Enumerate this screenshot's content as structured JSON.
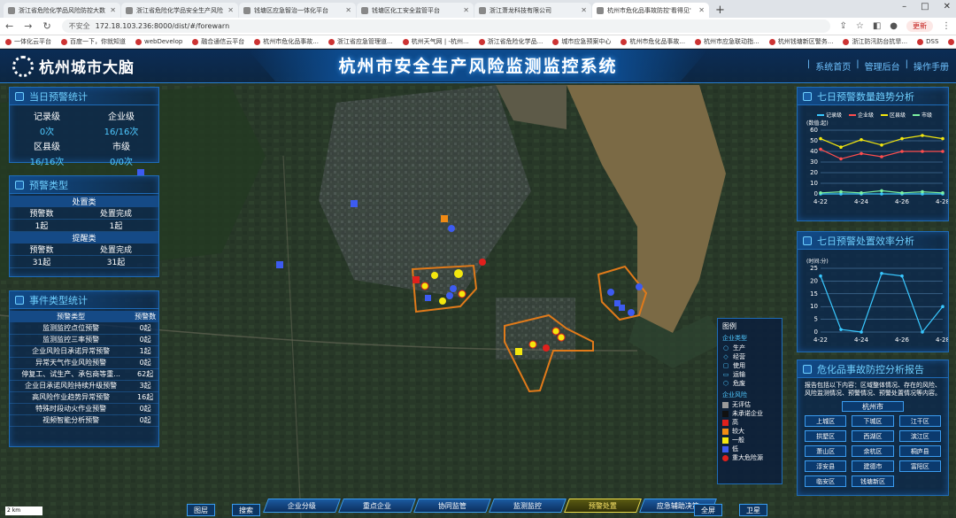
{
  "browser": {
    "tabs": [
      {
        "label": "浙江省危险化学品风险防控大数",
        "active": false
      },
      {
        "label": "浙江省危险化学品安全生产风险",
        "active": false
      },
      {
        "label": "钱塘区应急智治一体化平台",
        "active": false
      },
      {
        "label": "钱塘区化工安全监管平台",
        "active": false
      },
      {
        "label": "浙江萧龙科技有限公司",
        "active": false
      },
      {
        "label": "杭州市危化品事故防控'看得见'",
        "active": true
      }
    ],
    "new_tab": "+",
    "security": "不安全",
    "url": "172.18.103.236:8000/dist/#/forewarn",
    "update_btn": "更新",
    "bookmarks": [
      "一体化云平台",
      "百度一下，你就知道",
      "webDevelop",
      "融合通信云平台",
      "杭州市危化品事故...",
      "浙江省应急管理道...",
      "杭州天气网 | -杭州...",
      "浙江省危险化学品...",
      "城市应急预案中心",
      "杭州市危化品事故...",
      "杭州市应急联动指...",
      "杭州钱塘新区警务...",
      "浙江防汛防台抗旱...",
      "DSS",
      "实时监控调阅"
    ]
  },
  "header": {
    "logo": "杭州城市大脑",
    "title": "杭州市安全生产风险监测监控系统",
    "nav": [
      "系统首页",
      "管理后台",
      "操作手册"
    ]
  },
  "warning_stats": {
    "title": "当日预警统计",
    "items": [
      {
        "label": "记录级",
        "value": "0次"
      },
      {
        "label": "企业级",
        "value": "16/16次"
      },
      {
        "label": "区县级",
        "value": "16/16次"
      },
      {
        "label": "市级",
        "value": "0/0次"
      }
    ]
  },
  "warning_type": {
    "title": "预警类型",
    "group1": {
      "name": "处置类",
      "col1": "预警数",
      "col2": "处置完成",
      "v1": "1起",
      "v2": "1起"
    },
    "group2": {
      "name": "提醒类",
      "col1": "预警数",
      "col2": "处置完成",
      "v1": "31起",
      "v2": "31起"
    }
  },
  "event_stats": {
    "title": "事件类型统计",
    "headers": [
      "预警类型",
      "预警数"
    ],
    "rows": [
      [
        "监测监控点位预警",
        "0起"
      ],
      [
        "监测监控三率预警",
        "0起"
      ],
      [
        "企业风险日承诺异常预警",
        "1起"
      ],
      [
        "异常天气作业风险预警",
        "0起"
      ],
      [
        "停复工、试生产、承包商等重...",
        "62起"
      ],
      [
        "企业日承诺风险持续升级预警",
        "3起"
      ],
      [
        "高风险作业趋势异常预警",
        "16起"
      ],
      [
        "特殊时段动火作业预警",
        "0起"
      ],
      [
        "视频智能分析预警",
        "0起"
      ]
    ]
  },
  "trend": {
    "title": "七日预警数量趋势分析",
    "legend": [
      "记录级",
      "企业级",
      "区县级",
      "市级"
    ],
    "unit": "(数值:起)"
  },
  "rate": {
    "title": "七日预警处置效率分析",
    "unit": "(时间:分)"
  },
  "report": {
    "title": "危化品事故防控分析报告",
    "text": "报告包括以下内容：区域整体情况、存在的风险、风险监测情况、预警情况、预警处置情况等内容。",
    "city": "杭州市",
    "districts": [
      "上城区",
      "下城区",
      "江干区",
      "拱墅区",
      "西湖区",
      "滨江区",
      "萧山区",
      "余杭区",
      "桐庐县",
      "淳安县",
      "建德市",
      "富阳区",
      "临安区",
      "钱塘新区"
    ]
  },
  "legend": {
    "title": "图例",
    "sec1": "企业类型",
    "types": [
      "生产",
      "经营",
      "使用",
      "运输",
      "危废"
    ],
    "sec2": "企业风险",
    "risks": [
      {
        "label": "无评估",
        "color": "#9a9a9a"
      },
      {
        "label": "未承诺企业",
        "color": "#111111"
      },
      {
        "label": "高",
        "color": "#e0201c"
      },
      {
        "label": "较大",
        "color": "#f08a14"
      },
      {
        "label": "一般",
        "color": "#f3e70e"
      },
      {
        "label": "低",
        "color": "#3d5bf0"
      },
      {
        "label": "重大危险源",
        "color": "#e0201c"
      }
    ]
  },
  "bottom_nav": [
    "企业分级",
    "重点企业",
    "协同监管",
    "监测监控",
    "预警处置",
    "应急辅助决策"
  ],
  "bottom_active": "预警处置",
  "left_btns": [
    "图层",
    "搜索"
  ],
  "right_btns": [
    "全屏",
    "卫星"
  ],
  "scale": "2 km",
  "chart_data": [
    {
      "type": "line",
      "title": "七日预警数量趋势分析",
      "x": [
        "4-22",
        "4-23",
        "4-24",
        "4-25",
        "4-26",
        "4-27",
        "4-28"
      ],
      "ylim": [
        0,
        60
      ],
      "yticks": [
        0,
        10,
        20,
        30,
        40,
        50,
        60
      ],
      "ylabel": "(数值:起)",
      "series": [
        {
          "name": "记录级",
          "values": [
            0,
            0,
            0,
            0,
            0,
            0,
            0
          ],
          "color": "#39c8ff"
        },
        {
          "name": "企业级",
          "values": [
            42,
            33,
            38,
            35,
            40,
            40,
            40
          ],
          "color": "#ff4d4d"
        },
        {
          "name": "区县级",
          "values": [
            52,
            44,
            51,
            46,
            52,
            55,
            52
          ],
          "color": "#f3e70e"
        },
        {
          "name": "市级",
          "values": [
            1,
            2,
            1,
            3,
            1,
            2,
            1
          ],
          "color": "#7df0a0"
        }
      ]
    },
    {
      "type": "line",
      "title": "七日预警处置效率分析",
      "x": [
        "4-22",
        "4-23",
        "4-24",
        "4-25",
        "4-26",
        "4-27",
        "4-28"
      ],
      "ylim": [
        0,
        25
      ],
      "yticks": [
        0,
        5,
        10,
        15,
        20,
        25
      ],
      "ylabel": "(时间:分)",
      "series": [
        {
          "name": "处置效率",
          "values": [
            22,
            1,
            0,
            23,
            22,
            0,
            10
          ],
          "color": "#39c8ff"
        }
      ]
    }
  ]
}
